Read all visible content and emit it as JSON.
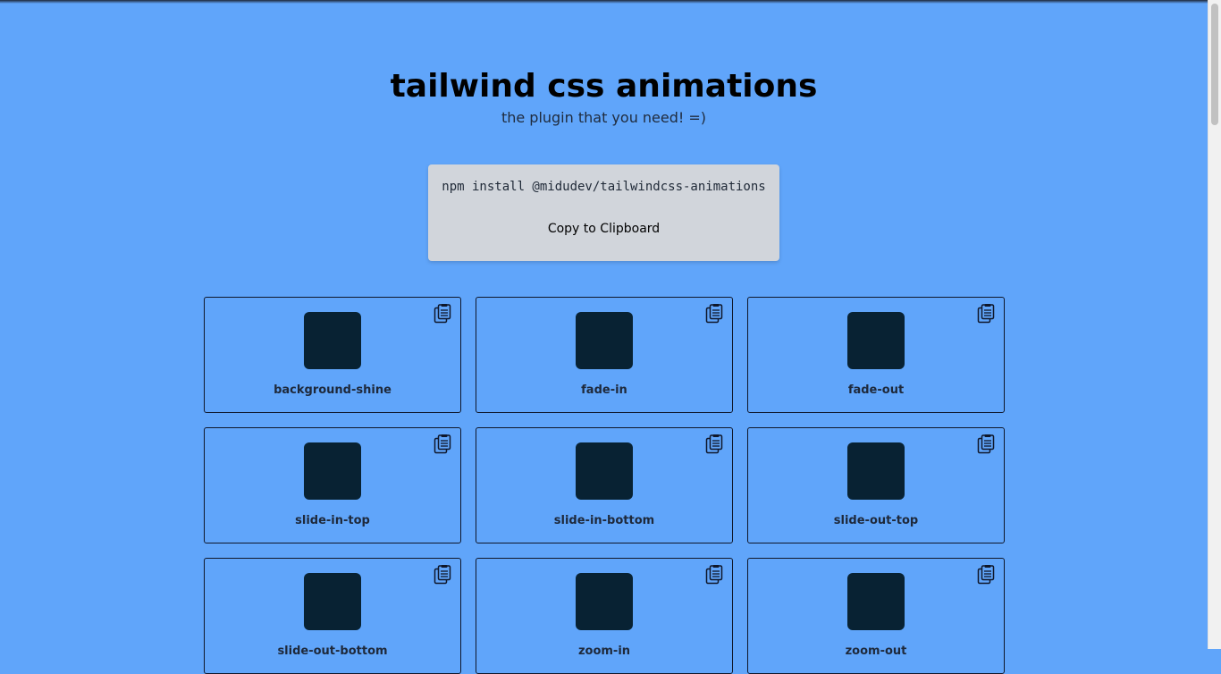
{
  "header": {
    "title": "tailwind css animations",
    "subtitle": "the plugin that you need! =)"
  },
  "install": {
    "command": "npm install @midudev/tailwindcss-animations",
    "copy_label": "Copy to Clipboard"
  },
  "animations": [
    {
      "name": "background-shine"
    },
    {
      "name": "fade-in"
    },
    {
      "name": "fade-out"
    },
    {
      "name": "slide-in-top"
    },
    {
      "name": "slide-in-bottom"
    },
    {
      "name": "slide-out-top"
    },
    {
      "name": "slide-out-bottom"
    },
    {
      "name": "zoom-in"
    },
    {
      "name": "zoom-out"
    }
  ],
  "colors": {
    "background": "#60a5fa",
    "square": "#082233",
    "install_card": "#d1d5db"
  },
  "icons": {
    "card_copy": "clipboard-icon"
  }
}
